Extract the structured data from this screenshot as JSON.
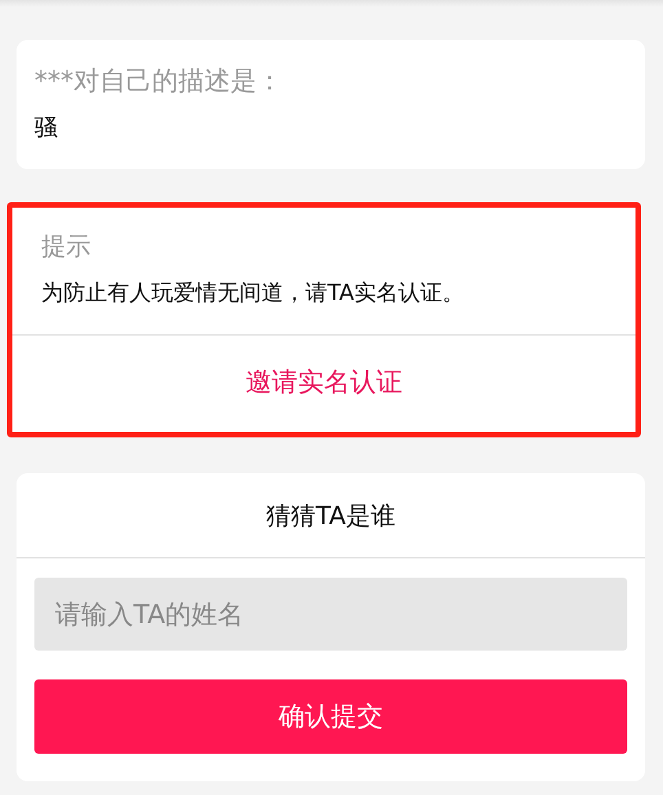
{
  "description_card": {
    "label": "***对自己的描述是：",
    "value": "骚"
  },
  "notice_card": {
    "highlighted": true,
    "title": "提示",
    "message": "为防止有人玩爱情无间道，请TA实名认证。",
    "action": "邀请实名认证"
  },
  "guess_card": {
    "title": "猜猜TA是谁",
    "name_field": {
      "placeholder": "请输入TA的姓名"
    },
    "submit_button": "确认提交"
  }
}
